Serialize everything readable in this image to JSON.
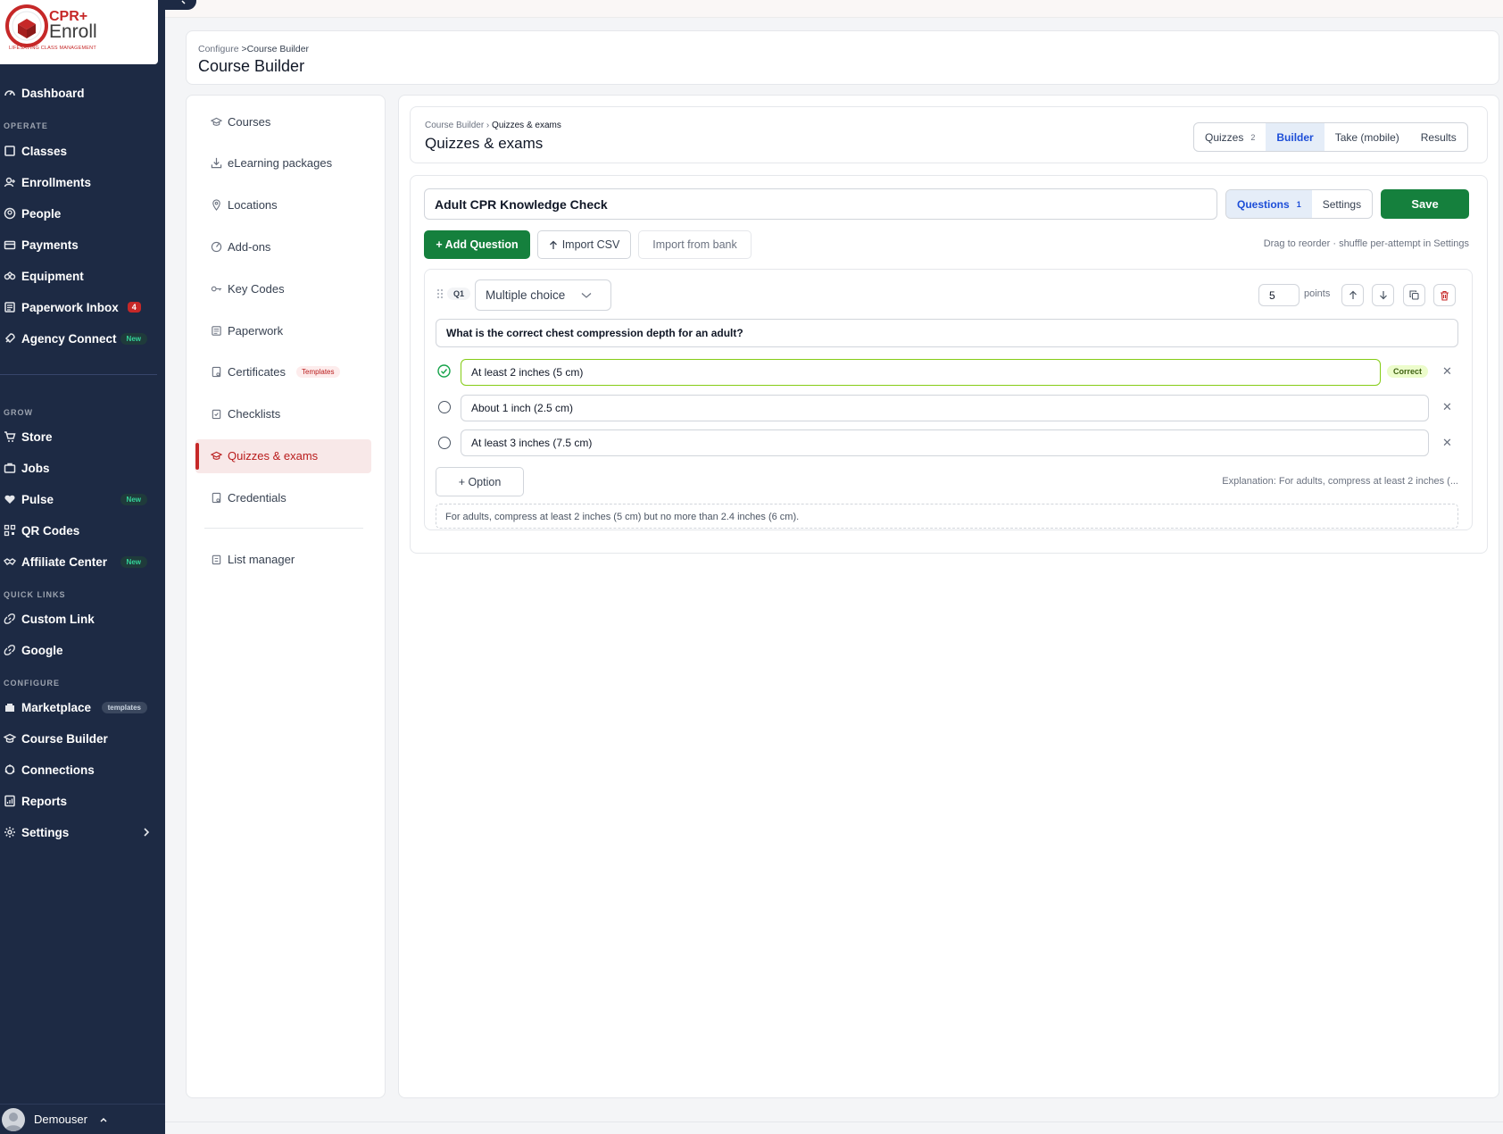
{
  "brand": {
    "name_top": "CPR+",
    "name_bottom": "Enroll",
    "tagline": "LIFESAVING CLASS MANAGEMENT"
  },
  "sidebar": {
    "dashboard": "Dashboard",
    "sections": {
      "operate": "OPERATE",
      "grow": "GROW",
      "quick_links": "QUICK LINKS",
      "configure": "CONFIGURE"
    },
    "operate": [
      {
        "label": "Classes",
        "icon": "book-icon"
      },
      {
        "label": "Enrollments",
        "icon": "user-add-icon"
      },
      {
        "label": "People",
        "icon": "person-circle-icon"
      },
      {
        "label": "Payments",
        "icon": "payments-icon"
      },
      {
        "label": "Equipment",
        "icon": "equipment-icon"
      },
      {
        "label": "Paperwork Inbox",
        "icon": "inbox-icon",
        "badge": "4"
      },
      {
        "label": "Agency Connect",
        "icon": "rocket-icon",
        "badge": "New"
      }
    ],
    "grow": [
      {
        "label": "Store",
        "icon": "cart-icon"
      },
      {
        "label": "Jobs",
        "icon": "briefcase-icon"
      },
      {
        "label": "Pulse",
        "icon": "heart-pulse-icon",
        "badge": "New"
      },
      {
        "label": "QR Codes",
        "icon": "qr-icon"
      },
      {
        "label": "Affiliate Center",
        "icon": "handshake-icon",
        "badge": "New"
      }
    ],
    "quick_links": [
      {
        "label": "Custom Link",
        "icon": "link-icon"
      },
      {
        "label": "Google",
        "icon": "link-icon"
      }
    ],
    "configure": [
      {
        "label": "Marketplace",
        "icon": "store-icon",
        "badge": "templates"
      },
      {
        "label": "Course Builder",
        "icon": "graduation-cap-icon"
      },
      {
        "label": "Connections",
        "icon": "connections-icon"
      },
      {
        "label": "Reports",
        "icon": "report-icon"
      },
      {
        "label": "Settings",
        "icon": "gear-icon"
      }
    ],
    "user": "Demouser"
  },
  "header": {
    "breadcrumb_parent": "Configure",
    "breadcrumb_current": "Course Builder",
    "title": "Course Builder"
  },
  "submenu": [
    {
      "label": "Courses"
    },
    {
      "label": "eLearning packages"
    },
    {
      "label": "Locations"
    },
    {
      "label": "Add-ons"
    },
    {
      "label": "Key Codes"
    },
    {
      "label": "Paperwork"
    },
    {
      "label": "Certificates",
      "tag": "Templates"
    },
    {
      "label": "Checklists"
    },
    {
      "label": "Quizzes & exams"
    },
    {
      "label": "Credentials"
    },
    {
      "label": "List manager"
    }
  ],
  "panel": {
    "breadcrumb_parent": "Course Builder",
    "breadcrumb_current": "Quizzes & exams",
    "title": "Quizzes & exams",
    "tabs": [
      {
        "label": "Quizzes",
        "count": "2"
      },
      {
        "label": "Builder"
      },
      {
        "label": "Take (mobile)"
      },
      {
        "label": "Results"
      }
    ]
  },
  "editor": {
    "quiz_title": "Adult CPR Knowledge Check",
    "view_tabs": [
      {
        "label": "Questions",
        "count": "1"
      },
      {
        "label": "Settings"
      }
    ],
    "save": "Save",
    "add_question": "+ Add Question",
    "import_csv": "Import CSV",
    "import_bank": "Import from bank",
    "hint": "Drag to reorder · shuffle per-attempt in Settings",
    "question": {
      "number": "Q1",
      "type": "Multiple choice",
      "points": "5",
      "points_label": "points",
      "text": "What is the correct chest compression depth for an adult?",
      "options": [
        {
          "text": "At least 2 inches (5 cm)",
          "correct": true,
          "badge": "Correct"
        },
        {
          "text": "About 1 inch (2.5 cm)",
          "correct": false
        },
        {
          "text": "At least 3 inches (7.5 cm)",
          "correct": false
        }
      ],
      "add_option": "+ Option",
      "explanation_preview": "Explanation: For adults, compress at least 2 inches (...",
      "explanation": "For adults, compress at least 2 inches (5 cm) but no more than 2.4 inches (6 cm)."
    }
  },
  "colors": {
    "sidebar": "#1d2a44",
    "brand_red": "#c62828",
    "green": "#15803d",
    "active_blue": "#1d4ed8"
  }
}
